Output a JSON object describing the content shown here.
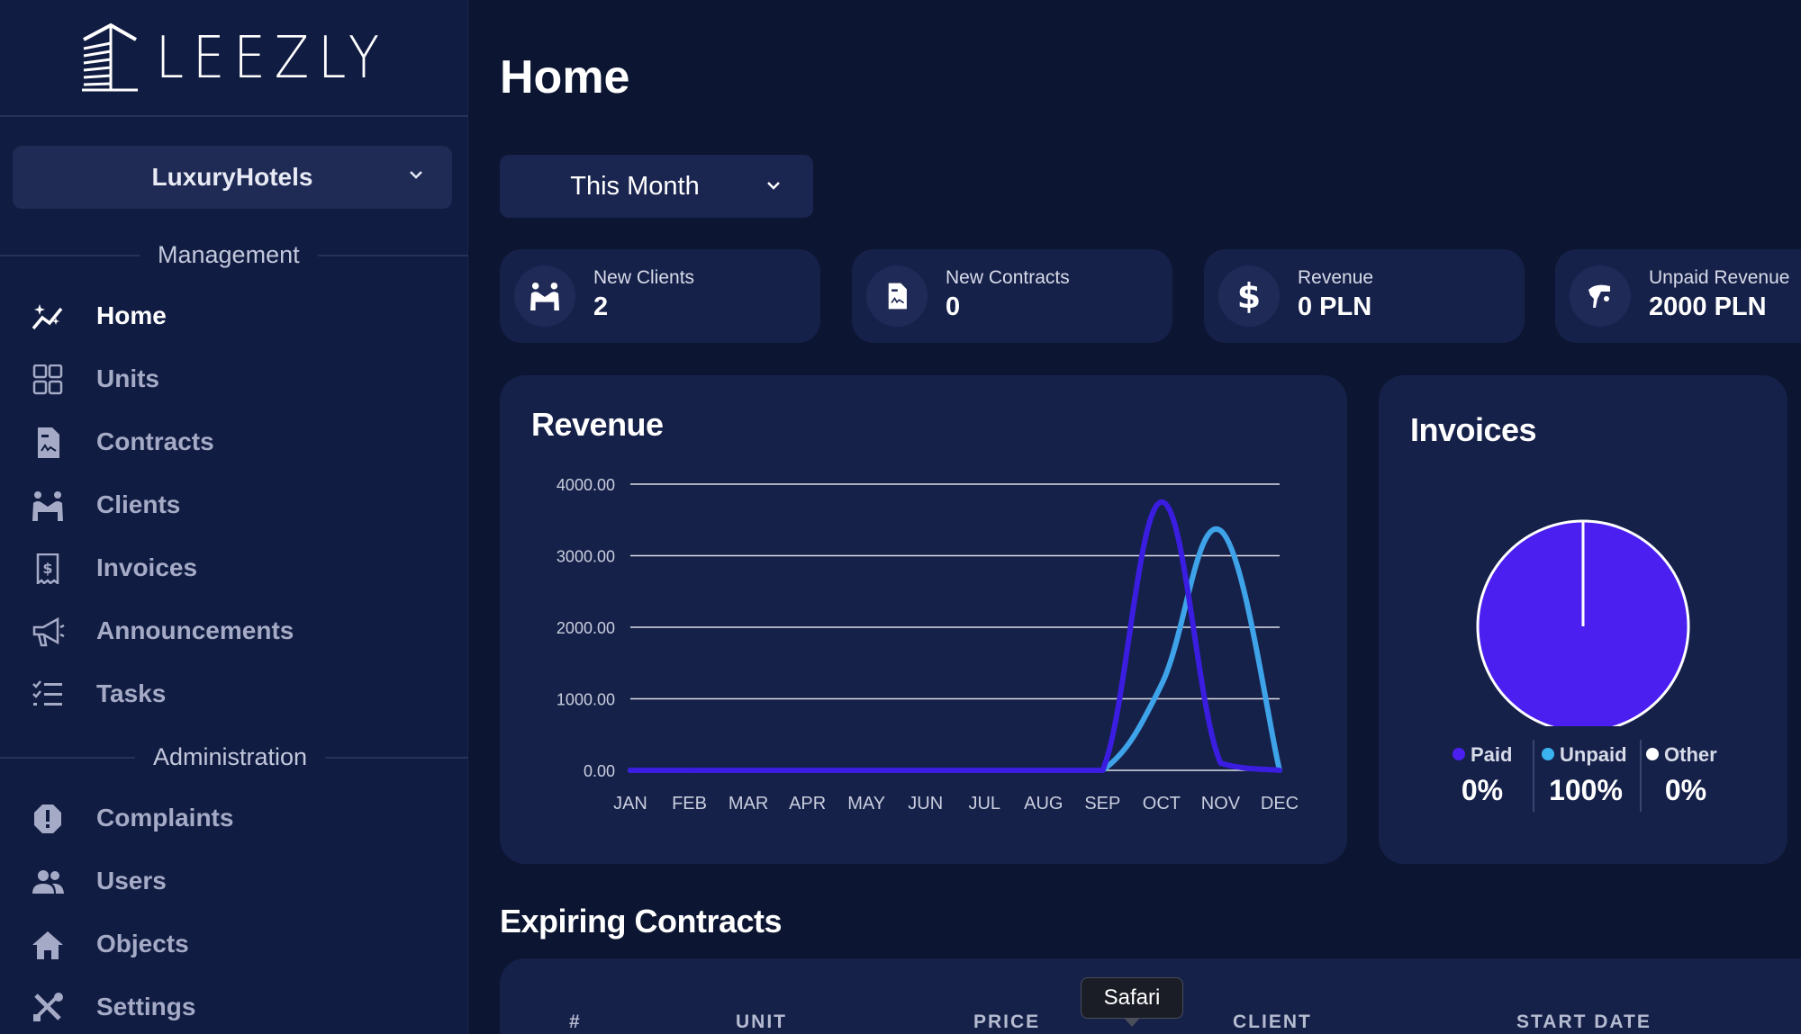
{
  "app": {
    "logo_text": "LEEZLY"
  },
  "sidebar": {
    "org_select": {
      "value": "LuxuryHotels"
    },
    "sections": {
      "management": "Management",
      "administration": "Administration"
    },
    "items": [
      {
        "label": "Home",
        "icon": "chart-sparkle-icon"
      },
      {
        "label": "Units",
        "icon": "grid-icon"
      },
      {
        "label": "Contracts",
        "icon": "document-icon"
      },
      {
        "label": "Clients",
        "icon": "people-handshake-icon"
      },
      {
        "label": "Invoices",
        "icon": "invoice-dollar-icon"
      },
      {
        "label": "Announcements",
        "icon": "megaphone-icon"
      },
      {
        "label": "Tasks",
        "icon": "checklist-icon"
      },
      {
        "label": "Complaints",
        "icon": "alert-icon"
      },
      {
        "label": "Users",
        "icon": "users-icon"
      },
      {
        "label": "Objects",
        "icon": "house-icon"
      },
      {
        "label": "Settings",
        "icon": "tools-icon"
      }
    ],
    "active": "Home"
  },
  "main": {
    "title": "Home",
    "period": {
      "value": "This Month"
    },
    "stats": [
      {
        "label": "New Clients",
        "value": "2",
        "icon": "people-handshake-icon"
      },
      {
        "label": "New Contracts",
        "value": "0",
        "icon": "document-icon"
      },
      {
        "label": "Revenue",
        "value": "0 PLN",
        "icon": "dollar-icon"
      },
      {
        "label": "Unpaid Revenue",
        "value": "2000 PLN",
        "icon": "hand-money-icon"
      }
    ],
    "revenue_card": {
      "title": "Revenue"
    },
    "invoices_card": {
      "title": "Invoices",
      "legend": [
        {
          "label": "Paid",
          "value": "0%",
          "color": "#4a1ff0"
        },
        {
          "label": "Unpaid",
          "value": "100%",
          "color": "#3ab3f0"
        },
        {
          "label": "Other",
          "value": "0%",
          "color": "#ffffff"
        }
      ]
    },
    "expiring": {
      "title": "Expiring Contracts",
      "columns": [
        "#",
        "UNIT",
        "PRICE",
        "CLIENT",
        "START DATE"
      ]
    }
  },
  "tooltip": {
    "text": "Safari"
  },
  "chart_data": [
    {
      "type": "line",
      "title": "Revenue",
      "categories": [
        "JAN",
        "FEB",
        "MAR",
        "APR",
        "MAY",
        "JUN",
        "JUL",
        "AUG",
        "SEP",
        "OCT",
        "NOV",
        "DEC"
      ],
      "y_ticks": [
        "4000.00",
        "3000.00",
        "2000.00",
        "1000.00",
        "0.00"
      ],
      "ylim": [
        0,
        4000
      ],
      "grid": true,
      "series": [
        {
          "color": "#3a1de0",
          "values": [
            0,
            0,
            0,
            0,
            0,
            0,
            0,
            0,
            0,
            3750,
            100,
            0
          ]
        },
        {
          "color": "#3ea3e8",
          "values": [
            0,
            0,
            0,
            0,
            0,
            0,
            0,
            0,
            0,
            1200,
            3350,
            0
          ]
        }
      ]
    },
    {
      "type": "pie",
      "title": "Invoices",
      "categories": [
        "Paid",
        "Unpaid",
        "Other"
      ],
      "values": [
        0,
        100,
        0
      ],
      "colors": [
        "#4a1ff0",
        "#4a1ff0",
        "#ffffff"
      ]
    }
  ]
}
